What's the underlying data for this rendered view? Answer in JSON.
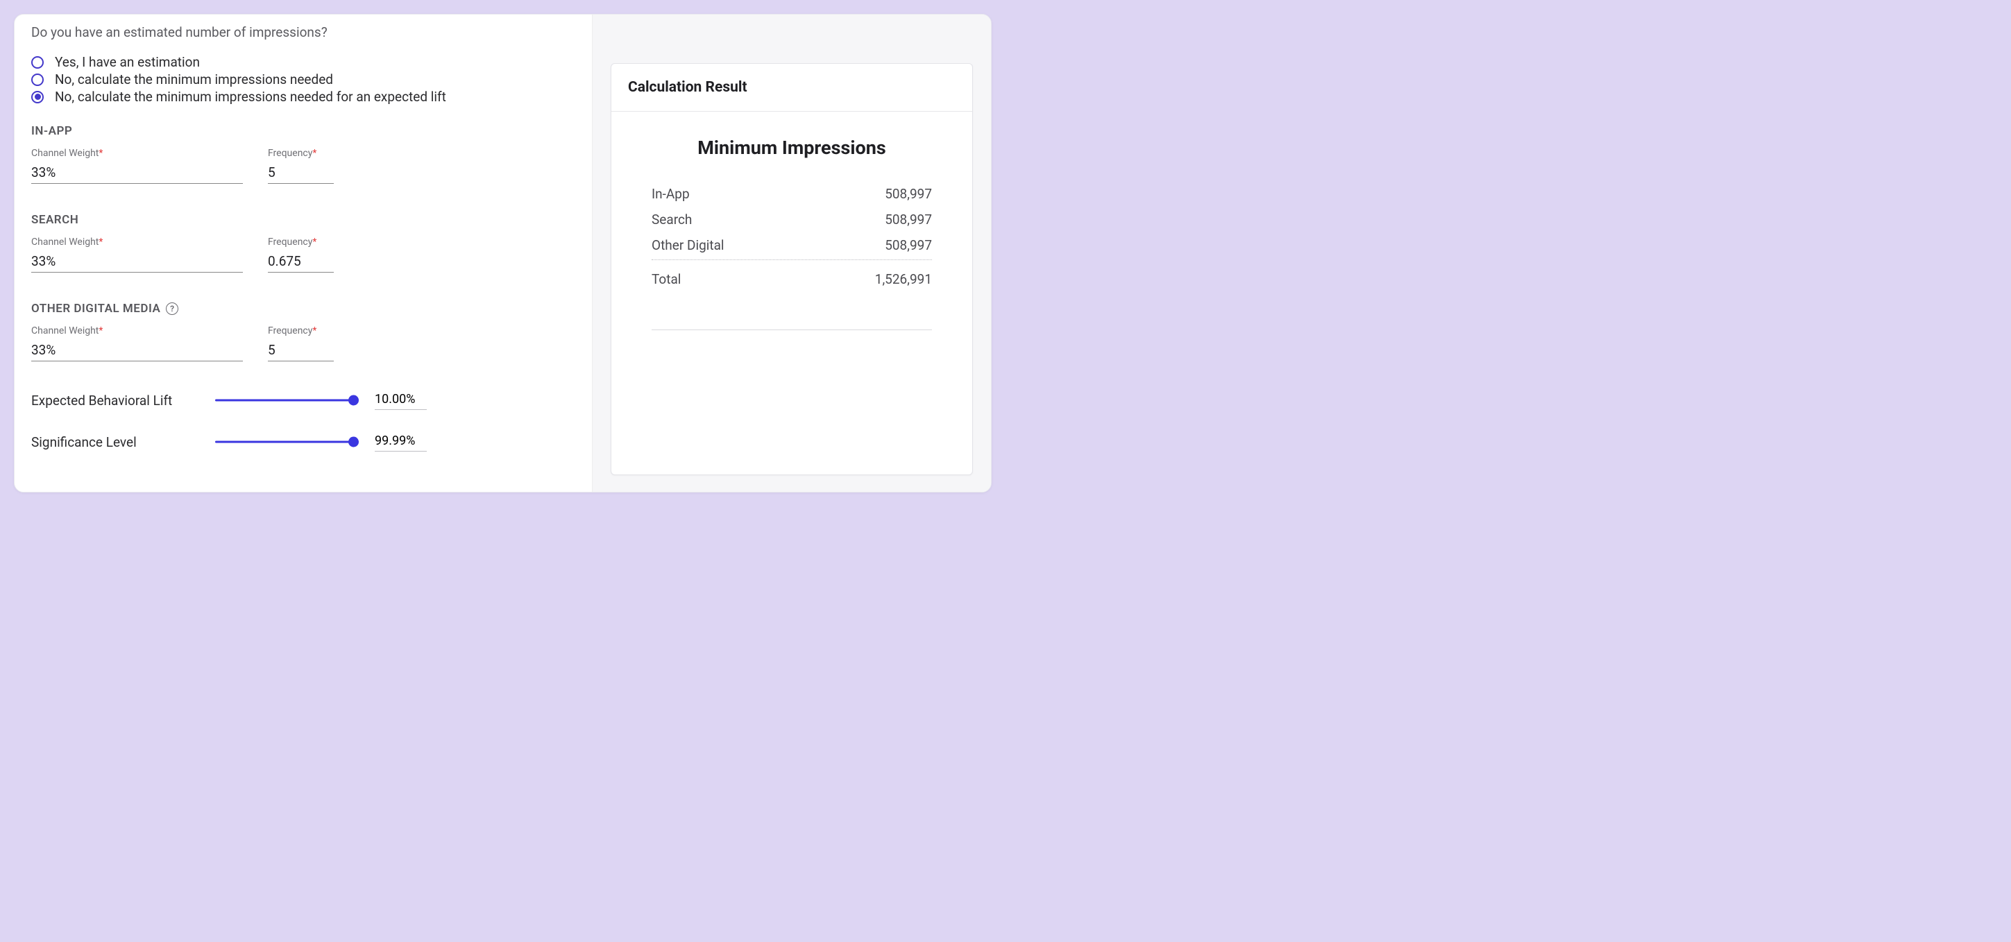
{
  "question": "Do you have an estimated number of impressions?",
  "radios": {
    "opt1": "Yes, I have an estimation",
    "opt2": "No, calculate the minimum impressions needed",
    "opt3": "No, calculate the minimum impressions needed for an expected lift"
  },
  "labels": {
    "channel_weight": "Channel Weight",
    "frequency": "Frequency"
  },
  "channels": {
    "inapp": {
      "title": "IN-APP",
      "weight": "33%",
      "freq": "5"
    },
    "search": {
      "title": "SEARCH",
      "weight": "33%",
      "freq": "0.675"
    },
    "other": {
      "title": "OTHER DIGITAL MEDIA",
      "weight": "33%",
      "freq": "5"
    }
  },
  "sliders": {
    "lift": {
      "label": "Expected Behavioral Lift",
      "value": "10.00%"
    },
    "sig": {
      "label": "Significance Level",
      "value": "99.99%"
    }
  },
  "result": {
    "card_title": "Calculation Result",
    "title": "Minimum Impressions",
    "rows": {
      "inapp": {
        "label": "In-App",
        "value": "508,997"
      },
      "search": {
        "label": "Search",
        "value": "508,997"
      },
      "other": {
        "label": "Other Digital",
        "value": "508,997"
      },
      "total": {
        "label": "Total",
        "value": "1,526,991"
      }
    }
  }
}
